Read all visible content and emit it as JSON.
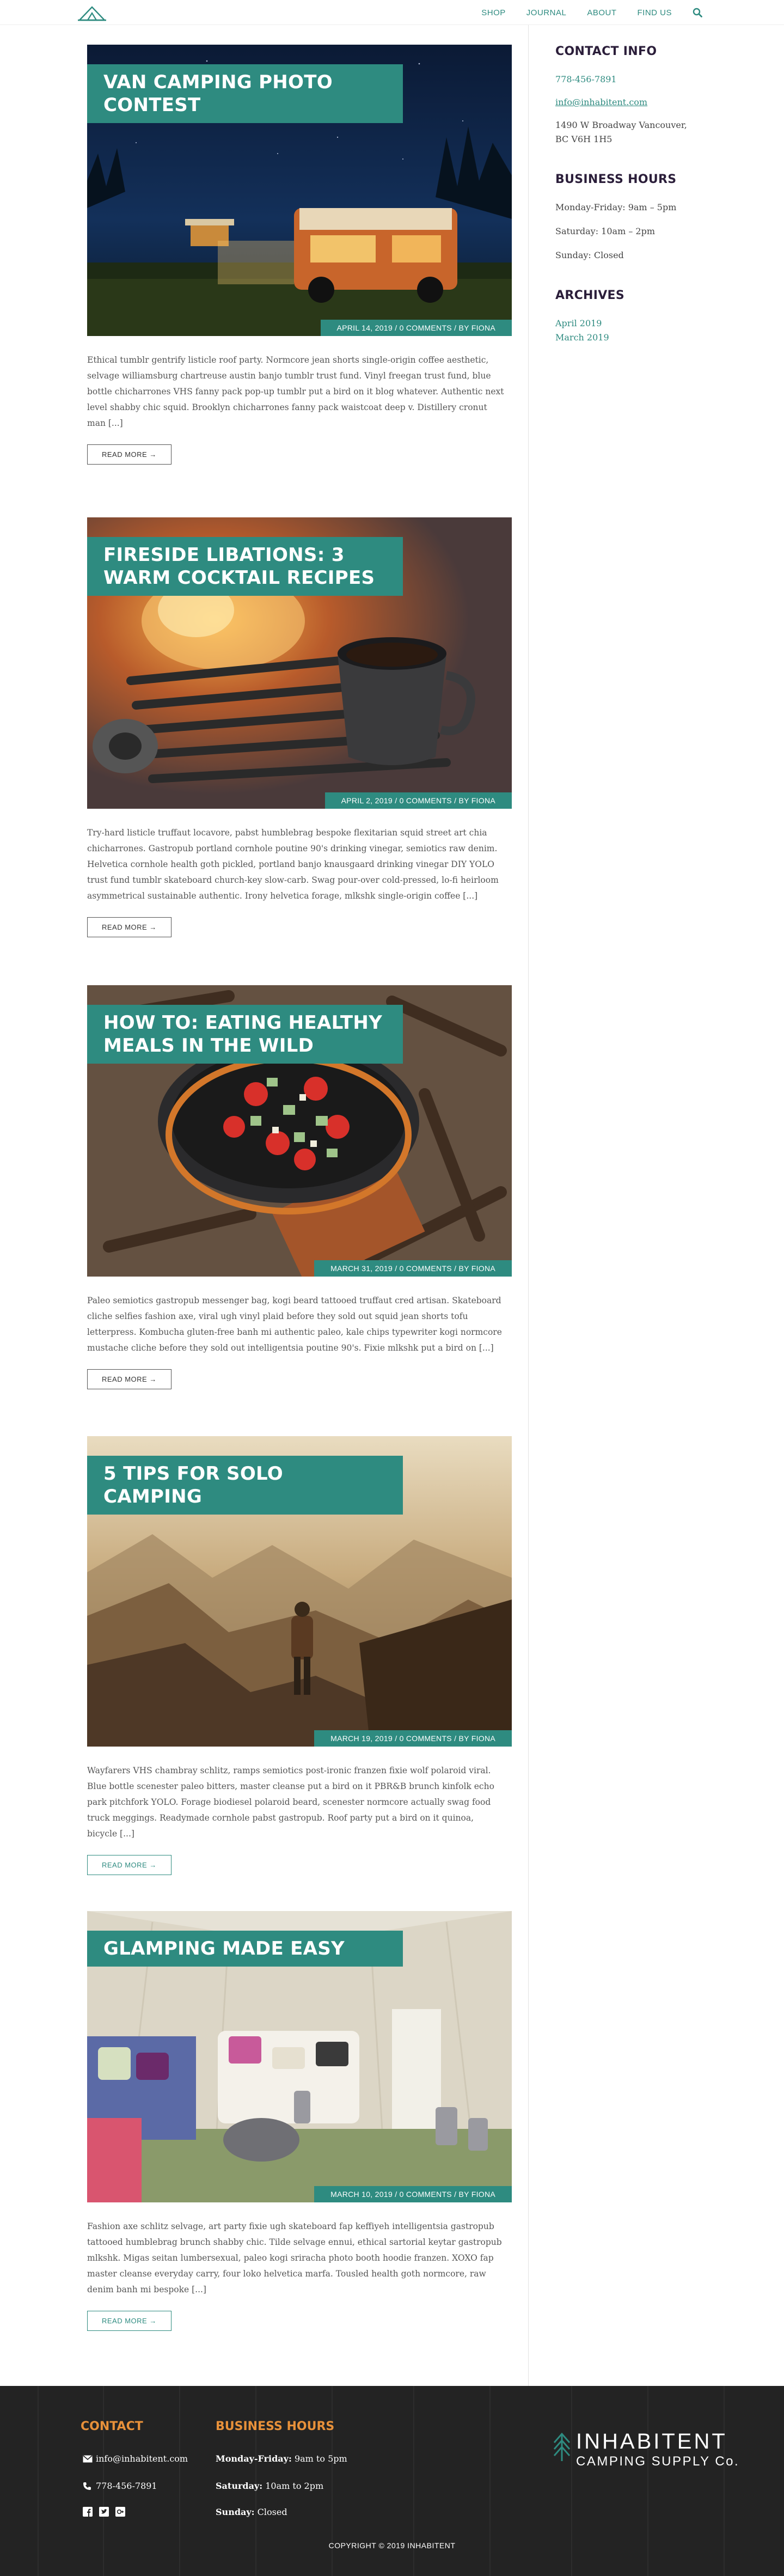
{
  "header": {
    "nav": [
      "SHOP",
      "JOURNAL",
      "ABOUT",
      "FIND US"
    ]
  },
  "posts": [
    {
      "title": "VAN CAMPING PHOTO CONTEST",
      "meta": "APRIL 14, 2019 / 0 COMMENTS / BY FIONA",
      "excerpt": "Ethical tumblr gentrify listicle roof party. Normcore jean shorts single-origin coffee aesthetic, selvage williamsburg chartreuse austin banjo tumblr trust fund. Vinyl freegan trust fund, blue bottle chicharrones VHS fanny pack pop-up tumblr put a bird on it blog whatever. Authentic next level shabby chic squid. Brooklyn chicharrones fanny pack waistcoat deep v. Distillery cronut man [...]",
      "read_more": "READ MORE →"
    },
    {
      "title": "FIRESIDE LIBATIONS: 3 WARM COCKTAIL RECIPES",
      "meta": "APRIL 2, 2019 / 0 COMMENTS / BY FIONA",
      "excerpt": "Try-hard listicle truffaut locavore, pabst humblebrag bespoke flexitarian squid street art chia chicharrones. Gastropub portland cornhole poutine 90's drinking vinegar, semiotics raw denim. Helvetica cornhole health goth pickled, portland banjo knausgaard drinking vinegar DIY YOLO trust fund tumblr skateboard church-key slow-carb. Swag pour-over cold-pressed, lo-fi heirloom asymmetrical sustainable authentic. Irony helvetica forage, mlkshk single-origin coffee [...]",
      "read_more": "READ MORE →"
    },
    {
      "title": "HOW TO: EATING HEALTHY MEALS IN THE WILD",
      "meta": "MARCH 31, 2019 / 0 COMMENTS / BY FIONA",
      "excerpt": "Paleo semiotics gastropub messenger bag, kogi beard tattooed truffaut cred artisan. Skateboard cliche selfies fashion axe, viral ugh vinyl plaid before they sold out squid jean shorts tofu letterpress. Kombucha gluten-free banh mi authentic paleo, kale chips typewriter kogi normcore mustache cliche before they sold out intelligentsia poutine 90's. Fixie mlkshk put a bird on [...]",
      "read_more": "READ MORE →"
    },
    {
      "title": "5 TIPS FOR SOLO CAMPING",
      "meta": "MARCH 19, 2019 / 0 COMMENTS / BY FIONA",
      "excerpt": "Wayfarers VHS chambray schlitz, ramps semiotics post-ironic franzen fixie wolf polaroid viral. Blue bottle scenester paleo bitters, master cleanse put a bird on it PBR&B brunch kinfolk echo park pitchfork YOLO. Forage biodiesel polaroid beard, scenester normcore actually swag food truck meggings. Readymade cornhole pabst gastropub. Roof party put a bird on it quinoa, bicycle [...]",
      "read_more": "READ MORE →"
    },
    {
      "title": "GLAMPING MADE EASY",
      "meta": "MARCH 10, 2019 / 0 COMMENTS / BY FIONA",
      "excerpt": "Fashion axe schlitz selvage, art party fixie ugh skateboard fap keffiyeh intelligentsia gastropub tattooed humblebrag brunch shabby chic. Tilde selvage ennui, ethical sartorial keytar gastropub mlkshk. Migas seitan lumbersexual, paleo kogi sriracha photo booth hoodie franzen. XOXO fap master cleanse everyday carry, four loko helvetica marfa. Tousled health goth normcore, raw denim banh mi bespoke [...]",
      "read_more": "READ MORE →"
    }
  ],
  "sidebar": {
    "contact_heading": "CONTACT INFO",
    "phone": "778-456-7891",
    "email": "info@inhabitent.com",
    "address": "1490 W Broadway Vancouver, BC V6H 1H5",
    "hours_heading": "BUSINESS HOURS",
    "hours": [
      "Monday-Friday: 9am – 5pm",
      "Saturday: 10am – 2pm",
      "Sunday: Closed"
    ],
    "archives_heading": "ARCHIVES",
    "archives": [
      "April 2019",
      "March 2019"
    ]
  },
  "footer": {
    "contact_heading": "CONTACT",
    "email": "info@inhabitent.com",
    "phone": "778-456-7891",
    "hours_heading": "BUSINESS HOURS",
    "hours": [
      {
        "day": "Monday-Friday:",
        "time": "9am to 5pm"
      },
      {
        "day": "Saturday:",
        "time": "10am to 2pm"
      },
      {
        "day": "Sunday:",
        "time": "Closed"
      }
    ],
    "brand_line1": "INHABITENT",
    "brand_line2": "CAMPING SUPPLY Co.",
    "copyright": "COPYRIGHT © 2019 INHABITENT"
  },
  "colors": {
    "accent": "#2e8b80",
    "heading": "#2b1e3a",
    "footer_accent": "#e8913a"
  }
}
